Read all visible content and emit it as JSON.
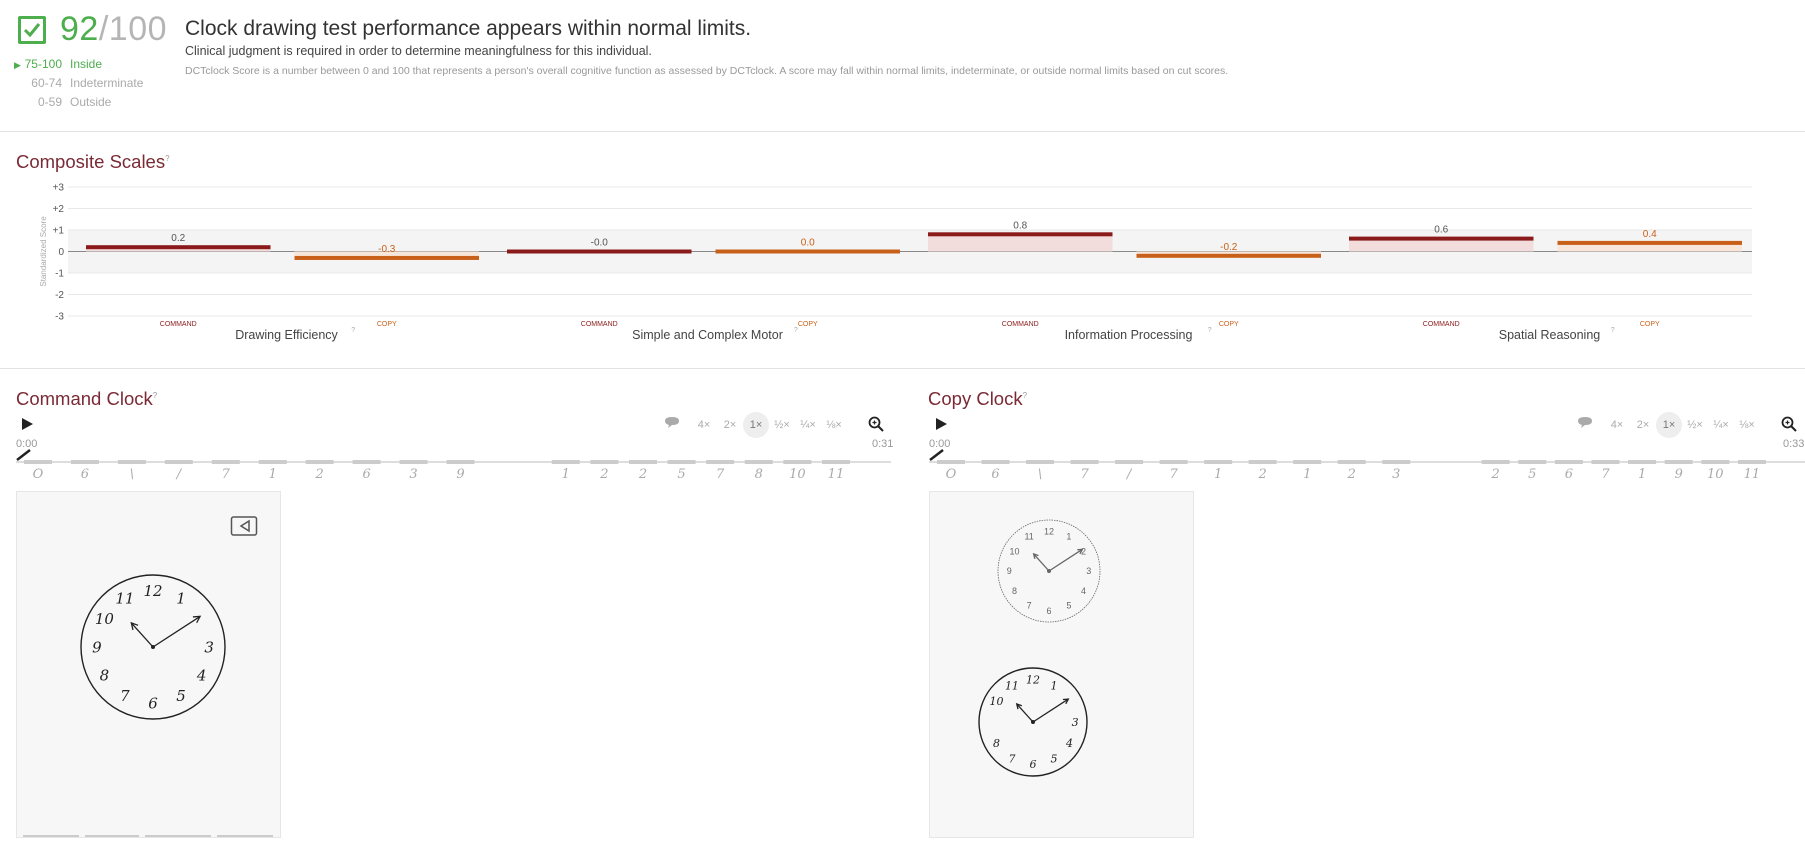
{
  "summary": {
    "score": "92",
    "slash": "/",
    "max": "100",
    "headline": "Clock drawing test performance appears within normal limits.",
    "subline": "Clinical judgment is required in order to determine meaningfulness for this individual.",
    "description": "DCTclock Score is a number between 0 and 100 that represents a person's overall cognitive function as assessed by DCTclock. A score may fall within normal limits, indeterminate, or outside normal limits based on cut scores.",
    "legend": [
      {
        "range": "75-100",
        "label": "Inside",
        "active": true
      },
      {
        "range": "60-74",
        "label": "Indeterminate",
        "active": false
      },
      {
        "range": "0-59",
        "label": "Outside",
        "active": false
      }
    ],
    "accent_color": "#4cae4c"
  },
  "composite": {
    "title": "Composite Scales",
    "help": "?"
  },
  "chart_data": {
    "type": "bar",
    "ylabel": "Standardized Score",
    "ylim": [
      -3,
      3
    ],
    "y_ticks": [
      "+3",
      "+2",
      "+1",
      "0",
      "-1",
      "-2",
      "-3"
    ],
    "groups": [
      "Drawing Efficiency",
      "Simple and Complex Motor",
      "Information Processing",
      "Spatial Reasoning"
    ],
    "categories": [
      "COMMAND",
      "COPY"
    ],
    "series": [
      {
        "name": "COMMAND",
        "color": "#8b1a1a",
        "values": [
          0.2,
          0.0,
          0.8,
          0.6
        ],
        "labels": [
          "0.2",
          "-0.0",
          "0.8",
          "0.6"
        ]
      },
      {
        "name": "COPY",
        "color": "#c8601a",
        "values": [
          -0.3,
          0.0,
          -0.2,
          0.4
        ],
        "labels": [
          "-0.3",
          "0.0",
          "-0.2",
          "0.4"
        ]
      }
    ],
    "grid": true
  },
  "command_clock": {
    "title": "Command Clock",
    "help": "?",
    "time_start": "0:00",
    "time_end": "0:31",
    "speeds": [
      "4×",
      "2×",
      "1×",
      "½×",
      "¼×",
      "⅛×"
    ],
    "selected_speed": "1×",
    "stroke_glyphs": [
      "O",
      "6",
      "\\",
      "/",
      "7",
      "1",
      "2",
      "6",
      "3",
      "9",
      "1",
      "2",
      "2",
      "5",
      "7",
      "8",
      "10",
      "11"
    ],
    "clock_numbers": [
      "12",
      "1",
      "3",
      "4",
      "5",
      "6",
      "7",
      "8",
      "9",
      "10",
      "11"
    ],
    "icons": {
      "play": "play-icon",
      "comment": "comment-icon",
      "zoom": "zoom-icon",
      "pen": "pen-icon",
      "replay": "replay-icon"
    }
  },
  "copy_clock": {
    "title": "Copy Clock",
    "help": "?",
    "time_start": "0:00",
    "time_end": "0:33",
    "speeds": [
      "4×",
      "2×",
      "1×",
      "½×",
      "¼×",
      "⅛×"
    ],
    "selected_speed": "1×",
    "stroke_glyphs": [
      "O",
      "6",
      "\\",
      "7",
      "/",
      "7",
      "1",
      "2",
      "1",
      "2",
      "3",
      "2",
      "5",
      "6",
      "7",
      "1",
      "9",
      "10",
      "11"
    ],
    "template_numbers": [
      "12",
      "1",
      "2",
      "3",
      "4",
      "5",
      "6",
      "7",
      "8",
      "9",
      "10",
      "11"
    ],
    "clock_numbers": [
      "12",
      "1",
      "3",
      "4",
      "5",
      "6",
      "7",
      "8",
      "10",
      "11"
    ]
  }
}
